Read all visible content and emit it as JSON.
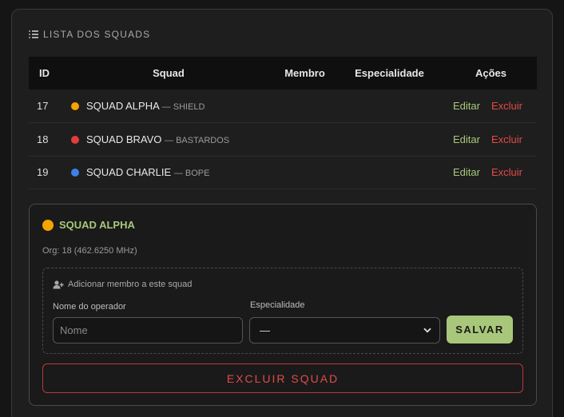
{
  "panel": {
    "title": "LISTA DOS SQUADS"
  },
  "table": {
    "headers": [
      "ID",
      "Squad",
      "Membro",
      "Especialidade",
      "Ações"
    ],
    "rows": [
      {
        "id": "17",
        "name": "SQUAD ALPHA",
        "org": "— SHIELD",
        "color": "#f5a300",
        "edit": "Editar",
        "delete": "Excluir"
      },
      {
        "id": "18",
        "name": "SQUAD BRAVO",
        "org": "— BASTARDOS",
        "color": "#e23c3c",
        "edit": "Editar",
        "delete": "Excluir"
      },
      {
        "id": "19",
        "name": "SQUAD CHARLIE",
        "org": "— BOPE",
        "color": "#3f7fe8",
        "edit": "Editar",
        "delete": "Excluir"
      }
    ]
  },
  "card": {
    "title": "SQUAD ALPHA",
    "color": "#f5a300",
    "org": "Org: 18 (462.6250 MHz)",
    "add_hint": "Adicionar membro a este squad",
    "name_label": "Nome do operador",
    "name_placeholder": "Nome",
    "spec_label": "Especialidade",
    "spec_value": "—",
    "save_label": "SALVAR",
    "delete_label": "EXCLUIR SQUAD"
  },
  "colors": {
    "accent": "#a9c77a",
    "danger": "#e24a4a"
  }
}
